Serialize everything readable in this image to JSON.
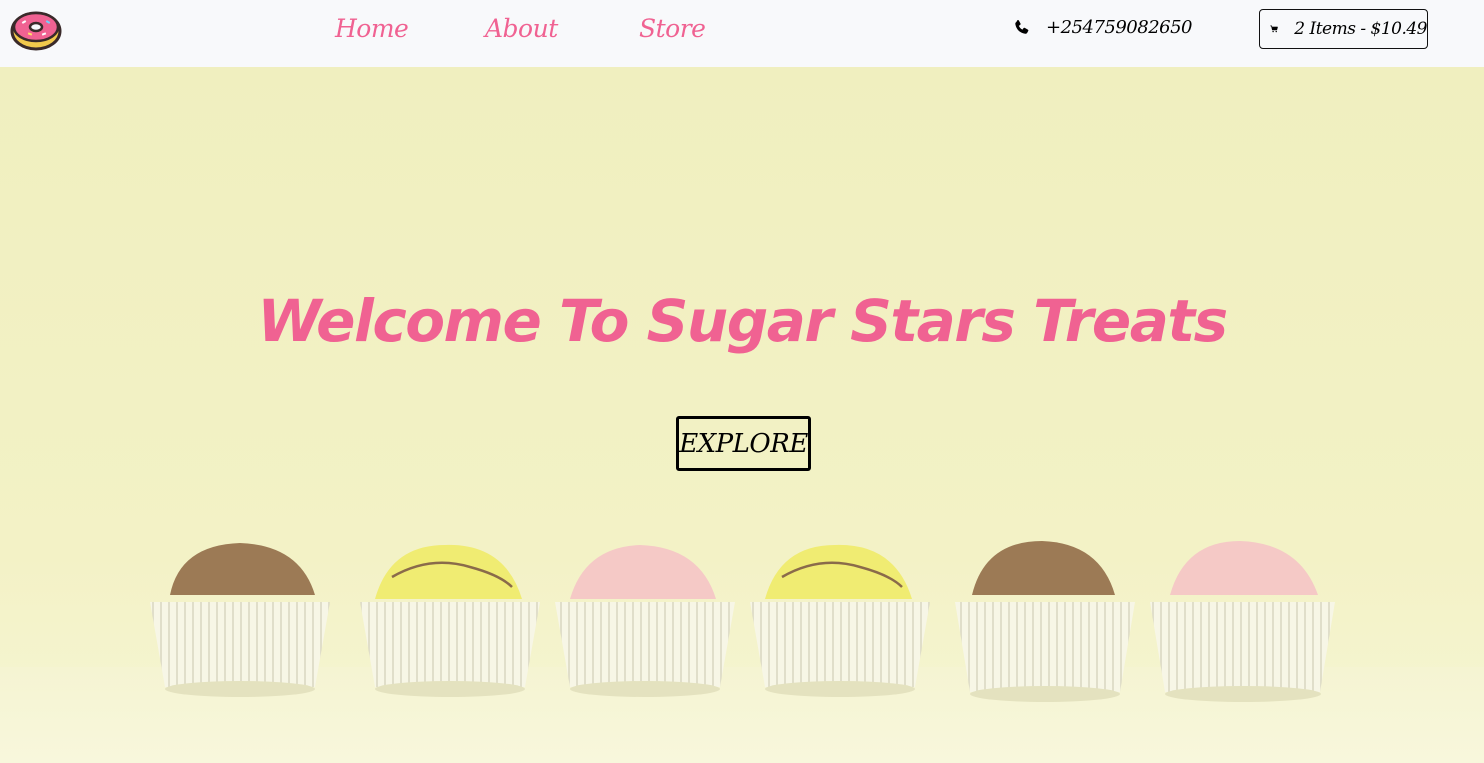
{
  "nav": {
    "logo_icon": "donut-icon",
    "links": [
      {
        "label": "Home"
      },
      {
        "label": "About"
      },
      {
        "label": "Store"
      }
    ],
    "phone_icon": "phone-icon",
    "phone": "+254759082650",
    "cart_icon": "shopping-cart-icon",
    "cart_label": "2 Items - $10.49"
  },
  "hero": {
    "title": "Welcome To Sugar Stars Treats",
    "button_label": "EXPLORE"
  },
  "colors": {
    "accent": "#f06292",
    "nav_bg": "#f8f9fb",
    "hero_bg": "#f2f1c2"
  }
}
